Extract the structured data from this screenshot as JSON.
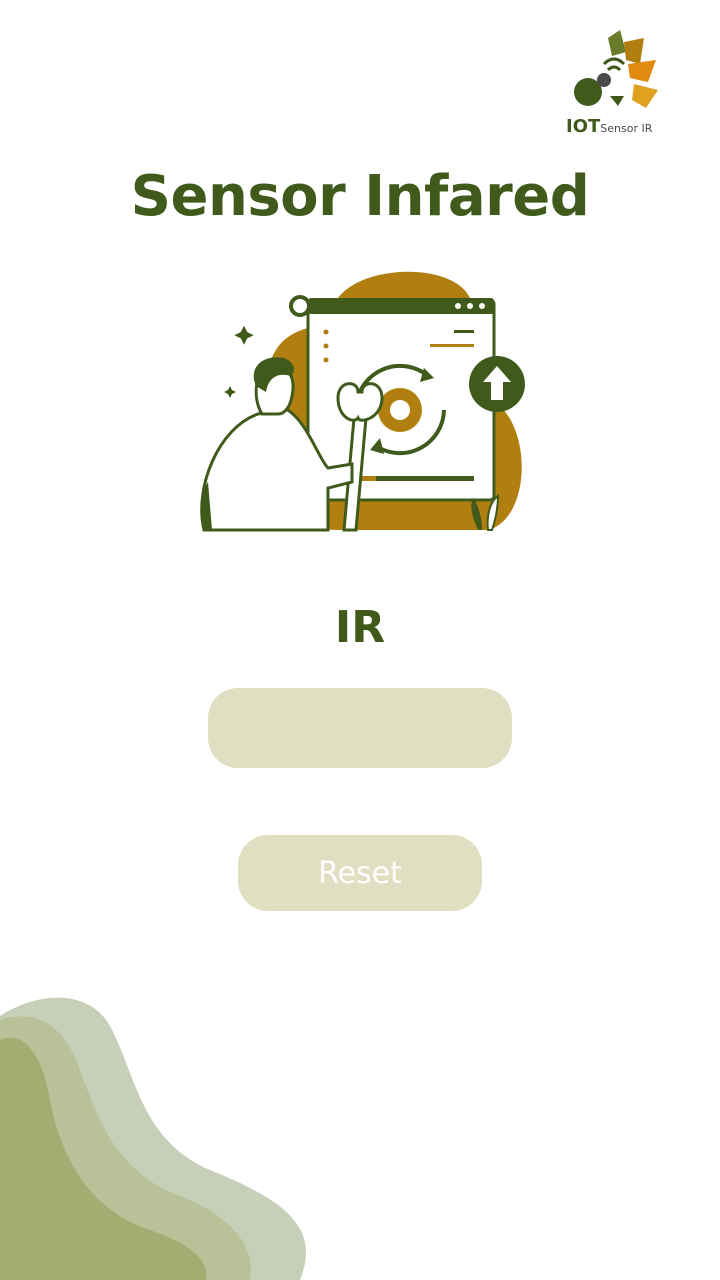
{
  "logo": {
    "brand": "IOT",
    "product": "Sensor IR",
    "icon": "iot-sensor-logo-icon"
  },
  "header": {
    "title": "Sensor Infared"
  },
  "illustration": {
    "icon": "settings-update-illustration"
  },
  "sensor": {
    "label": "IR",
    "value": ""
  },
  "actions": {
    "reset_label": "Reset"
  },
  "colors": {
    "primary": "#3f5a1a",
    "accent": "#b07f10",
    "field_bg": "#e0dfc2"
  }
}
